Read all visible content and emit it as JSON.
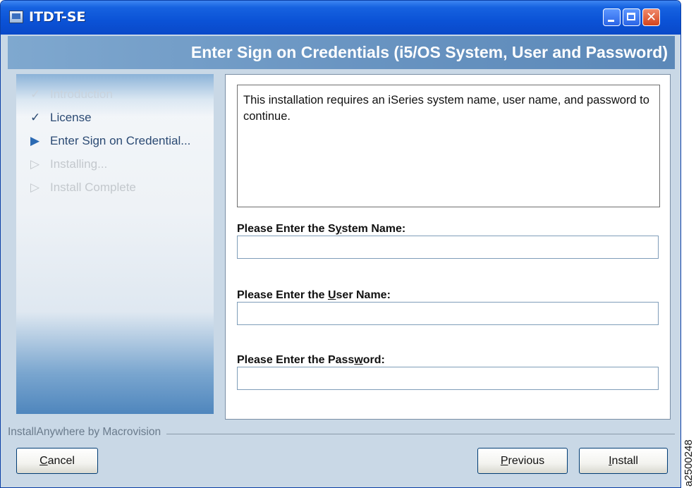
{
  "window": {
    "title": "ITDT-SE"
  },
  "header": {
    "title": "Enter Sign on Credentials (i5/OS System, User and Password)"
  },
  "steps": [
    {
      "mark": "✓",
      "label": "Introduction"
    },
    {
      "mark": "✓",
      "label": "License"
    },
    {
      "mark": "▶",
      "label": "Enter Sign on Credential..."
    },
    {
      "mark": "▷",
      "label": "Installing..."
    },
    {
      "mark": "▷",
      "label": "Install Complete"
    }
  ],
  "main": {
    "intro_text": "This installation requires an iSeries system name, user name, and password to continue.",
    "system_label": {
      "before": "Please Enter the S",
      "accel": "y",
      "after": "stem Name:"
    },
    "user_label": {
      "before": "Please Enter the ",
      "accel": "U",
      "after": "ser Name:"
    },
    "password_label": {
      "before": "Please Enter the Pass",
      "accel": "w",
      "after": "ord:"
    },
    "system_value": "",
    "user_value": "",
    "password_value": ""
  },
  "footer": {
    "brand": "InstallAnywhere by Macrovision",
    "cancel": {
      "accel": "C",
      "rest": "ancel"
    },
    "previous": {
      "accel": "P",
      "rest": "revious"
    },
    "install": {
      "accel": "I",
      "rest": "nstall"
    }
  },
  "side_code": "a2500248",
  "icons": {
    "app": "installer-app-icon",
    "minimize": "minimize-icon",
    "maximize": "maximize-icon",
    "close": "close-icon"
  }
}
